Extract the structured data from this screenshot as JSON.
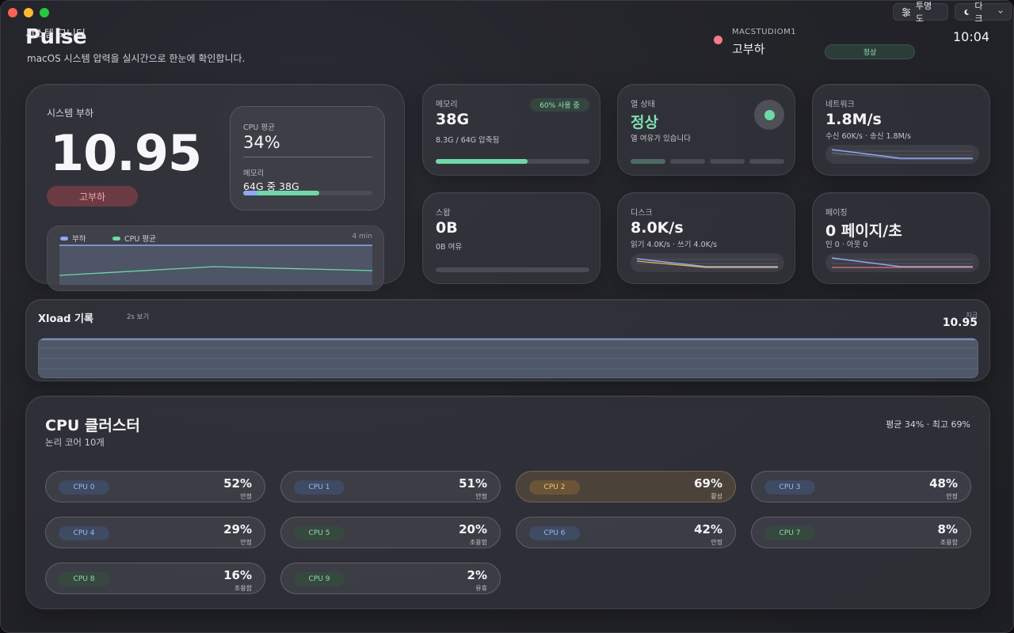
{
  "toolbar": {
    "opacity_label": "투명도",
    "theme_label": "다크"
  },
  "header": {
    "app_name": "Pulse",
    "app_subtitle": "시스템 모니터",
    "description": "macOS 시스템 압력을 실시간으로 한눈에 확인합니다.",
    "host_name": "MACSTUDIOM1",
    "host_state": "고부하",
    "status_pill": "정상",
    "clock": "10:04"
  },
  "load": {
    "title": "시스템 부하",
    "value": "10.95",
    "badge": "고부하",
    "cpu_label": "CPU 평균",
    "cpu_value": "34%",
    "mem_label": "메모리",
    "mem_value": "64G 중 38G",
    "mem_fraction": 0.59,
    "legend_load": "부하",
    "legend_cpu": "CPU 평균",
    "window_label": "4 min"
  },
  "memory": {
    "label": "메모리",
    "value": "38G",
    "badge": "60% 사용 중",
    "sub": "8.3G / 64G 압축됨",
    "fraction": 0.6
  },
  "thermal": {
    "label": "열 상태",
    "value": "정상",
    "sub": "열 여유가 있습니다",
    "level_segments": 4,
    "level_active": 1
  },
  "network": {
    "label": "네트워크",
    "value": "1.8M/s",
    "sub": "수신 60K/s · 송신 1.8M/s"
  },
  "swap": {
    "label": "스왑",
    "value": "0B",
    "sub": "0B 여유",
    "fraction": 0
  },
  "disk": {
    "label": "디스크",
    "value": "8.0K/s",
    "sub": "읽기 4.0K/s · 쓰기 4.0K/s"
  },
  "paging": {
    "label": "페이징",
    "value": "0 페이지/초",
    "sub": "인 0 · 아웃 0"
  },
  "xload": {
    "title": "Xload 기록",
    "interval": "2s 보기",
    "now_label": "지금",
    "now_value": "10.95"
  },
  "cpu": {
    "title": "CPU 클러스터",
    "subtitle": "논리 코어 10개",
    "summary": "평균 34% · 최고 69%",
    "cores": [
      {
        "name": "CPU 0",
        "pct": "52%",
        "state": "안정",
        "tone": "blue"
      },
      {
        "name": "CPU 1",
        "pct": "51%",
        "state": "안정",
        "tone": "blue"
      },
      {
        "name": "CPU 2",
        "pct": "69%",
        "state": "활성",
        "tone": "amber"
      },
      {
        "name": "CPU 3",
        "pct": "48%",
        "state": "안정",
        "tone": "blue"
      },
      {
        "name": "CPU 4",
        "pct": "29%",
        "state": "안정",
        "tone": "blue"
      },
      {
        "name": "CPU 5",
        "pct": "20%",
        "state": "조용함",
        "tone": "green"
      },
      {
        "name": "CPU 6",
        "pct": "42%",
        "state": "안정",
        "tone": "blue"
      },
      {
        "name": "CPU 7",
        "pct": "8%",
        "state": "조용함",
        "tone": "green"
      },
      {
        "name": "CPU 8",
        "pct": "16%",
        "state": "조용함",
        "tone": "green"
      },
      {
        "name": "CPU 9",
        "pct": "2%",
        "state": "유휴",
        "tone": "green"
      }
    ]
  },
  "colors": {
    "accent_green": "#6ed8a7",
    "danger": "#f27d86",
    "line_blue": "#8fa8f2",
    "line_amber": "#e8b657",
    "line_red": "#e0757e"
  }
}
